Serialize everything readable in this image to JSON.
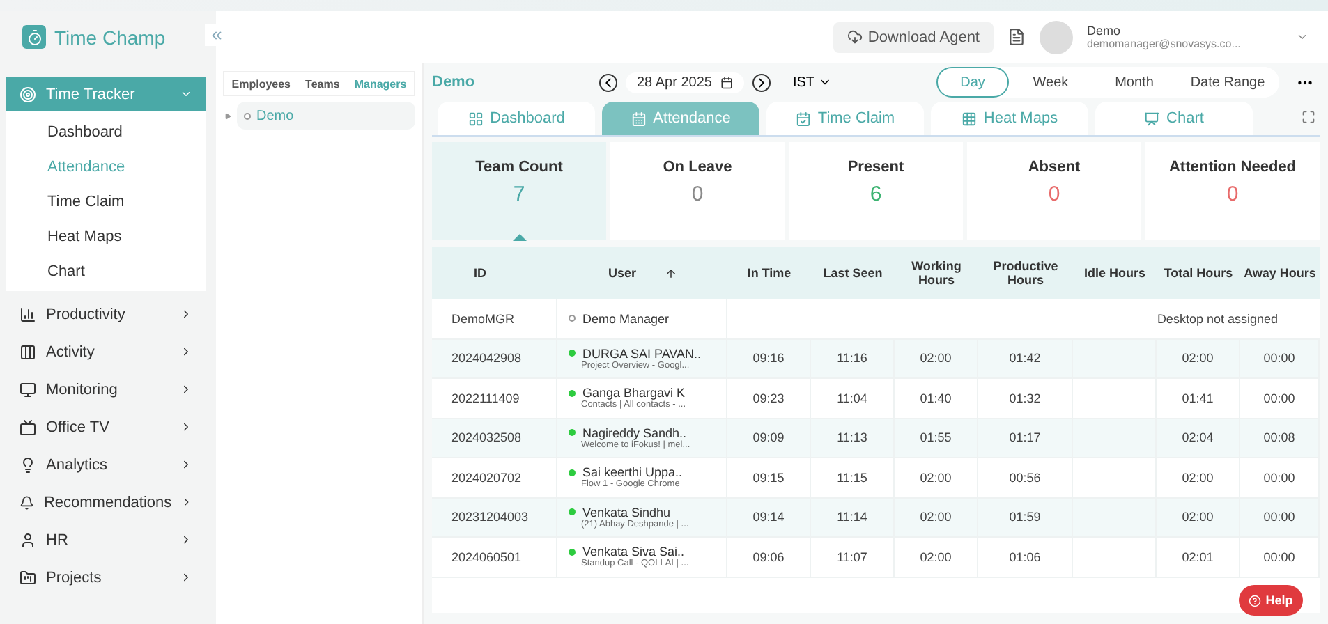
{
  "brand": "Time Champ",
  "header": {
    "download": "Download Agent",
    "user_name": "Demo",
    "user_email": "demomanager@snovasys.co..."
  },
  "sidebar": {
    "items": [
      {
        "label": "Time Tracker",
        "expanded": true,
        "children": [
          {
            "label": "Dashboard",
            "selected": false
          },
          {
            "label": "Attendance",
            "selected": true
          },
          {
            "label": "Time Claim",
            "selected": false
          },
          {
            "label": "Heat Maps",
            "selected": false
          },
          {
            "label": "Chart",
            "selected": false
          }
        ]
      },
      {
        "label": "Productivity",
        "expanded": false
      },
      {
        "label": "Activity",
        "expanded": false
      },
      {
        "label": "Monitoring",
        "expanded": false
      },
      {
        "label": "Office TV",
        "expanded": false
      },
      {
        "label": "Analytics",
        "expanded": false
      },
      {
        "label": "Recommendations",
        "expanded": false
      },
      {
        "label": "HR",
        "expanded": false
      },
      {
        "label": "Projects",
        "expanded": false
      }
    ]
  },
  "tree": {
    "tabs": [
      {
        "label": "Employees",
        "selected": false
      },
      {
        "label": "Teams",
        "selected": false
      },
      {
        "label": "Managers",
        "selected": true
      }
    ],
    "nodes": [
      {
        "label": "Demo"
      }
    ]
  },
  "toolbar": {
    "group": "Demo",
    "date": "28 Apr 2025",
    "timezone": "IST",
    "periods": [
      {
        "label": "Day",
        "selected": true
      },
      {
        "label": "Week",
        "selected": false
      },
      {
        "label": "Month",
        "selected": false
      },
      {
        "label": "Date Range",
        "selected": false
      }
    ]
  },
  "tabs": [
    {
      "label": "Dashboard",
      "selected": false
    },
    {
      "label": "Attendance",
      "selected": true
    },
    {
      "label": "Time Claim",
      "selected": false
    },
    {
      "label": "Heat Maps",
      "selected": false
    },
    {
      "label": "Chart",
      "selected": false
    }
  ],
  "stats": [
    {
      "label": "Team Count",
      "value": "7",
      "color": "#4aa9a7",
      "selected": true
    },
    {
      "label": "On Leave",
      "value": "0",
      "color": "#8a8a8a",
      "selected": false
    },
    {
      "label": "Present",
      "value": "6",
      "color": "#3cb371",
      "selected": false
    },
    {
      "label": "Absent",
      "value": "0",
      "color": "#e86b6b",
      "selected": false
    },
    {
      "label": "Attention Needed",
      "value": "0",
      "color": "#e86b6b",
      "selected": false
    }
  ],
  "table": {
    "columns": [
      "ID",
      "User",
      "In Time",
      "Last Seen",
      "Working Hours",
      "Productive Hours",
      "Idle Hours",
      "Total Hours",
      "Away Hours"
    ],
    "rows": [
      {
        "kind": "unassigned",
        "id": "DemoMGR",
        "user": "Demo Manager",
        "online": false,
        "note": "Desktop not assigned"
      },
      {
        "kind": "tracked",
        "id": "2024042908",
        "user": "DURGA SAI PAVAN..",
        "activity": "Project Overview - Googl...",
        "online": true,
        "in": "09:16",
        "last": "11:16",
        "working": "02:00",
        "productive": "01:42",
        "total": "02:00",
        "away": "00:00"
      },
      {
        "kind": "tracked",
        "id": "2022111409",
        "user": "Ganga Bhargavi K",
        "activity": "Contacts | All contacts - ...",
        "online": true,
        "in": "09:23",
        "last": "11:04",
        "working": "01:40",
        "productive": "01:32",
        "total": "01:41",
        "away": "00:00"
      },
      {
        "kind": "tracked",
        "id": "2024032508",
        "user": "Nagireddy Sandh..",
        "activity": "Welcome to iFokus! | mel...",
        "online": true,
        "in": "09:09",
        "last": "11:13",
        "working": "01:55",
        "productive": "01:17",
        "total": "02:04",
        "away": "00:08"
      },
      {
        "kind": "tracked",
        "id": "2024020702",
        "user": "Sai keerthi Uppa..",
        "activity": "Flow 1 - Google Chrome",
        "online": true,
        "in": "09:15",
        "last": "11:15",
        "working": "02:00",
        "productive": "00:56",
        "total": "02:00",
        "away": "00:00"
      },
      {
        "kind": "tracked",
        "id": "20231204003",
        "user": "Venkata Sindhu",
        "activity": "(21) Abhay Deshpande | ...",
        "online": true,
        "in": "09:14",
        "last": "11:14",
        "working": "02:00",
        "productive": "01:59",
        "total": "02:00",
        "away": "00:00"
      },
      {
        "kind": "tracked",
        "id": "2024060501",
        "user": "Venkata Siva Sai..",
        "activity": "Standup Call - QOLLAI | ...",
        "online": true,
        "in": "09:06",
        "last": "11:07",
        "working": "02:00",
        "productive": "01:06",
        "total": "02:01",
        "away": "00:00"
      }
    ]
  },
  "help": "Help"
}
